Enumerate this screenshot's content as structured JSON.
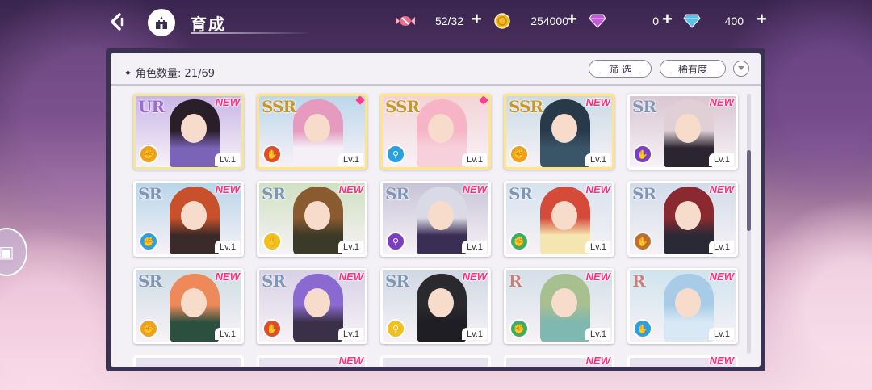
{
  "header": {
    "title": "育成"
  },
  "resources": [
    {
      "name": "candy",
      "icon": "candy-icon",
      "value": "52/32"
    },
    {
      "name": "gold",
      "icon": "gold-coin-icon",
      "value": "254000"
    },
    {
      "name": "purple-gem",
      "icon": "purple-diamond-icon",
      "value": "0"
    },
    {
      "name": "blue-gem",
      "icon": "blue-diamond-icon",
      "value": "400"
    }
  ],
  "panel": {
    "count_label": "角色数量: 21/69",
    "filter_label": "筛 选",
    "rarity_label": "稀有度"
  },
  "cards": [
    {
      "rarity": "UR",
      "new": "NEW",
      "level": "Lv.1",
      "role_color": "#f0a020",
      "bg": "#c9b6e8",
      "hair": "#2a1e28",
      "outfit": "#7b63b8"
    },
    {
      "rarity": "SSR",
      "new": "",
      "marked": true,
      "level": "Lv.1",
      "role_color": "#e04d2a",
      "bg": "#bcd7ec",
      "hair": "#e69ac0",
      "outfit": "#f4f0f6"
    },
    {
      "rarity": "SSR",
      "new": "",
      "marked": true,
      "level": "Lv.1",
      "role_color": "#2aa0e0",
      "bg": "#f3d4d8",
      "hair": "#f7b4c6",
      "outfit": "#f6d0da"
    },
    {
      "rarity": "SSR",
      "new": "NEW",
      "level": "Lv.1",
      "role_color": "#f0a020",
      "bg": "#c9dbe6",
      "hair": "#283a4a",
      "outfit": "#3a5468"
    },
    {
      "rarity": "SR",
      "new": "NEW",
      "level": "Lv.1",
      "role_color": "#7a3ec0",
      "bg": "#d9c6d2",
      "hair": "#e0cfd4",
      "outfit": "#2a2530"
    },
    {
      "rarity": "SR",
      "new": "NEW",
      "level": "Lv.1",
      "role_color": "#2aa0e0",
      "bg": "#b9d5ea",
      "hair": "#c8502a",
      "outfit": "#3a2a2a"
    },
    {
      "rarity": "SR",
      "new": "NEW",
      "level": "Lv.1",
      "role_color": "#f0c020",
      "bg": "#cfe1c2",
      "hair": "#8a5a30",
      "outfit": "#3b3a28"
    },
    {
      "rarity": "SR",
      "new": "NEW",
      "level": "Lv.1",
      "role_color": "#7a3ec0",
      "bg": "#c8c4d8",
      "hair": "#dadae6",
      "outfit": "#3a2e54"
    },
    {
      "rarity": "SR",
      "new": "NEW",
      "level": "Lv.1",
      "role_color": "#3ab060",
      "bg": "#d6e2ee",
      "hair": "#d64a3a",
      "outfit": "#f3e6b0"
    },
    {
      "rarity": "SR",
      "new": "NEW",
      "level": "Lv.1",
      "role_color": "#c0702a",
      "bg": "#d2dcea",
      "hair": "#8a2a30",
      "outfit": "#2a2a36"
    },
    {
      "rarity": "SR",
      "new": "NEW",
      "level": "Lv.1",
      "role_color": "#f0a020",
      "bg": "#cfdde4",
      "hair": "#ee8a5a",
      "outfit": "#2c5040"
    },
    {
      "rarity": "SR",
      "new": "NEW",
      "level": "Lv.1",
      "role_color": "#e04d2a",
      "bg": "#d8d0e6",
      "hair": "#8a6ad0",
      "outfit": "#3a3048"
    },
    {
      "rarity": "SR",
      "new": "NEW",
      "level": "Lv.1",
      "role_color": "#f0c020",
      "bg": "#cfd8e4",
      "hair": "#2a2a2e",
      "outfit": "#1e1e24"
    },
    {
      "rarity": "R",
      "new": "NEW",
      "level": "Lv.1",
      "role_color": "#3ab060",
      "bg": "#d4dfe8",
      "hair": "#a8c090",
      "outfit": "#7fb8b0"
    },
    {
      "rarity": "R",
      "new": "NEW",
      "level": "Lv.1",
      "role_color": "#2aa0e0",
      "bg": "#cfe4ee",
      "hair": "#a8cce8",
      "outfit": "#d8e8f4"
    }
  ],
  "peek_cards": [
    {
      "new": ""
    },
    {
      "new": "NEW"
    },
    {
      "new": ""
    },
    {
      "new": "NEW"
    },
    {
      "new": "NEW"
    }
  ]
}
